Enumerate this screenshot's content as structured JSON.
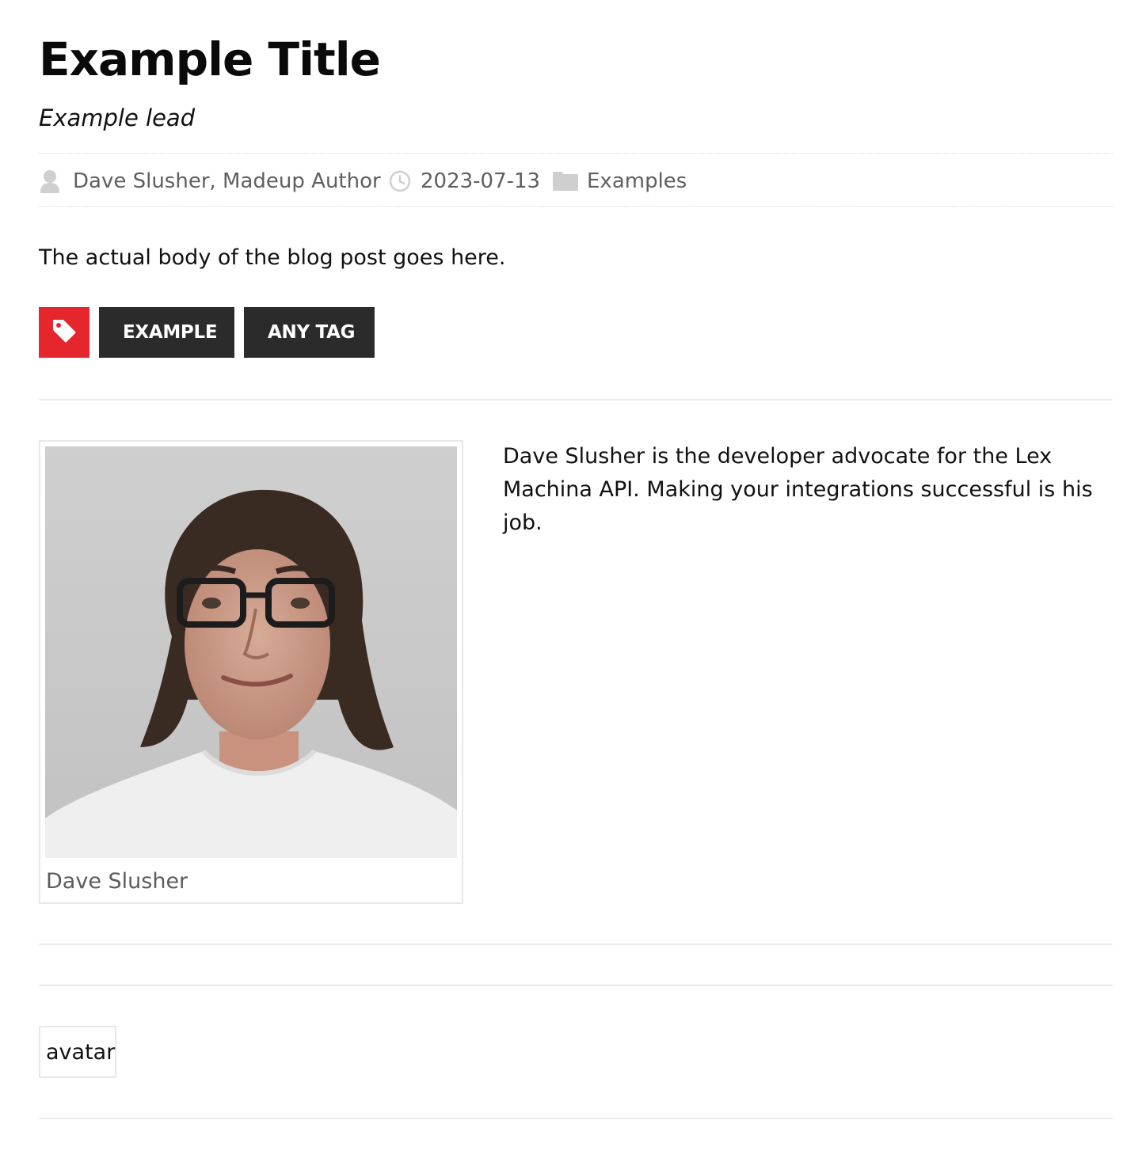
{
  "post": {
    "title": "Example Title",
    "lead": "Example lead",
    "body": "The actual body of the blog post goes here."
  },
  "meta": {
    "author": "Dave Slusher, Madeup Author",
    "author_icon": "user-icon",
    "date": "2023-07-13",
    "date_icon": "clock-icon",
    "category": "Examples",
    "category_icon": "folder-icon"
  },
  "tags": {
    "icon": "tag-icon",
    "icon_color": "#e5262d",
    "items": [
      "EXAMPLE",
      "ANY TAG"
    ]
  },
  "author_box": {
    "caption": "Dave Slusher",
    "bio": "Dave Slusher is the developer advocate for the Lex Machina API. Making your integrations successful is his job.",
    "photo_alt": "Dave Slusher"
  },
  "avatar": {
    "alt_text": "avatar"
  }
}
